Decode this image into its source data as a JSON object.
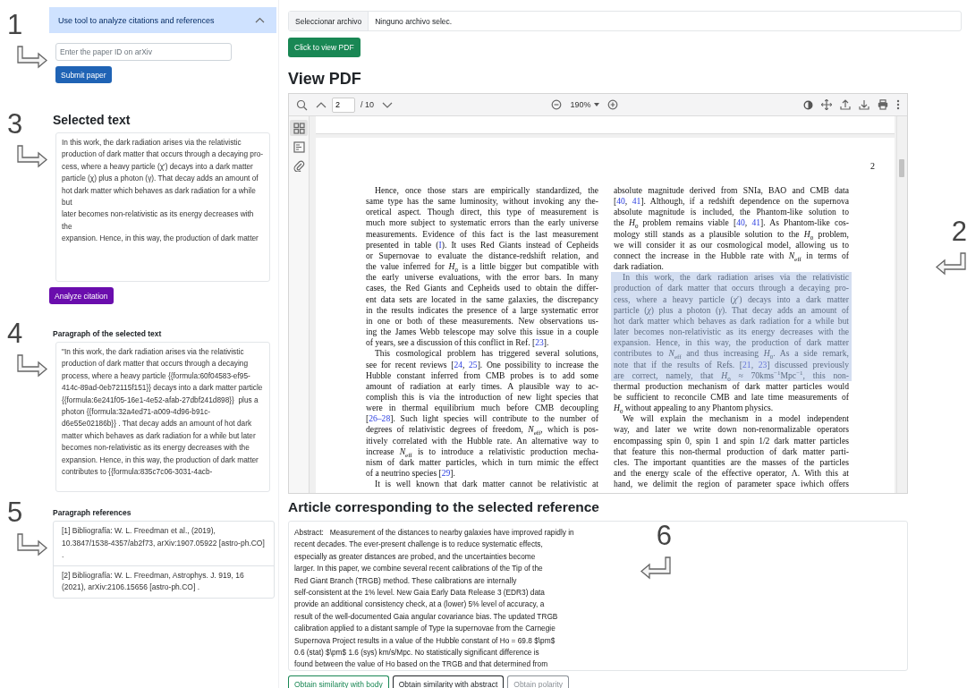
{
  "sidebar": {
    "accordion": {
      "title": "Use tool to analyze citations and references",
      "expanded": true
    },
    "paper_id_field": {
      "placeholder": "Enter the paper ID on arXiv",
      "marker": {
        "label": "1",
        "kind": "right"
      }
    },
    "submit_button": "Submit paper",
    "selected_text": {
      "heading": "Selected text",
      "value": "In this work, the dark radiation arises via the relativistic production of dark matter that occurs through a decaying pro-\ncess, where a heavy particle (χ′) decays into a dark matter particle (χ) plus a photon (γ). That decay adds an amount of\nhot dark matter which behaves as dark radiation for a while but\nlater becomes non-relativistic as its energy decreases with the\nexpansion. Hence, in this way, the production of dark matter",
      "marker": {
        "label": "3",
        "kind": "right"
      }
    },
    "analyze_button": "Analyze citation",
    "paragraph": {
      "heading": "Paragraph of the selected text",
      "value": "\"In this work, the dark radiation arises via the relativistic production of dark matter that occurs through a decaying process, where a heavy particle {{formula:60f04583-ef95-414c-89ad-0eb72115f151}} decays into a dark matter particle {{formula:6e241f05-16e1-4e52-afab-27dbf241d898}}  plus a photon {{formula:32a4ed71-a009-4d96-b91c-d6e55e02186b}} . That decay adds an amount of hot dark matter which behaves as dark radiation for a while but later becomes non-relativistic as its energy decreases with the expansion. Hence, in this way, the production of dark matter contributes to {{formula:835c7c06-3031-4acb-",
      "marker": {
        "label": "4",
        "kind": "right"
      }
    },
    "references": {
      "heading": "Paragraph references",
      "items": [
        "[1] Bibliografía: W. L. Freedman et al., (2019), 10.3847/1538-4357/ab2f73, arXiv:1907.05922 [astro-ph.CO] .",
        "[2] Bibliografía: W. L. Freedman, Astrophys. J. 919, 16 (2021), arXiv:2106.15656 [astro-ph.CO] ."
      ],
      "marker": {
        "label": "5",
        "kind": "right"
      }
    }
  },
  "file_input": {
    "button": "Seleccionar archivo",
    "value": "Ninguno archivo selec."
  },
  "view_pdf_button": "Click to view PDF",
  "pdf_heading": "View PDF",
  "pdf_viewer": {
    "page_field": "2",
    "page_count": "/ 10",
    "zoom": "190%",
    "marker": {
      "label": "2",
      "kind": "left"
    },
    "sidebar_tools": [
      {
        "kind": "thumbnails",
        "selected": true
      },
      {
        "kind": "outline",
        "selected": false
      },
      {
        "kind": "attachments",
        "selected": false
      }
    ],
    "page": {
      "number": "2",
      "columns": [
        {
          "blocks": [
            {
              "indent": true,
              "selected": false,
              "lines": [
                "Hence, once those stars are empirically standardized, the",
                "same type has the same luminosity, without invoking any the-",
                "oretical aspect.  Though direct, this type of measurement is",
                "much more subject to systematic errors than the early universe",
                "measurements. Evidence of this fact is the last measurement",
                [
                  "presented in table (",
                  {
                    "ref": "I"
                  },
                  "). It uses Red Giants instead of Cepheids"
                ],
                "or Supernovae to evaluate the distance-redshift relation, and",
                "the value inferred for *H*$_{0}$ is a little bigger but compatible with",
                "the early universe evaluations, with the error bars.  In many",
                "cases, the Red Giants and Cepheids used to obtain the differ-",
                "ent data sets are located in the same galaxies, the discrepancy",
                "in the results indicates the presence of a large systematic error",
                "in one or both of these measurements.  New observations us-",
                "ing the James Webb telescope may solve this issue in a couple",
                [
                  "of years, see a discussion of this conflict in Ref. [",
                  {
                    "ref": "23"
                  },
                  "]."
                ]
              ]
            },
            {
              "indent": true,
              "selected": false,
              "lines": [
                "This cosmological problem has triggered several solutions,",
                [
                  "see for recent reviews [",
                  {
                    "ref": "24"
                  },
                  ", ",
                  {
                    "ref": "25"
                  },
                  "]. One possibility to increase the"
                ],
                "Hubble constant inferred from CMB probes is to add some",
                "amount of radiation at early times.  A plausible way to ac-",
                "complish this is via the introduction of new light species that",
                "were in thermal equilibrium much before CMB decoupling",
                [
                  "[",
                  {
                    "ref": "26–28"
                  },
                  "]. Such light species will contribute to the number of"
                ],
                "degrees of relativistic degrees of freedom, *N*$_{eff}$, which is pos-",
                "itively correlated with the Hubble rate. An alternative way to",
                "increase *N*$_{eff}$ is to introduce a relativistic production mecha-",
                "nism of dark matter particles, which in turn mimic the effect",
                [
                  "of a neutrino species [",
                  {
                    "ref": "29"
                  },
                  "]."
                ]
              ]
            },
            {
              "indent": true,
              "selected": false,
              "lines": [
                "It is well known that dark matter cannot be relativistic at"
              ]
            }
          ]
        },
        {
          "blocks": [
            {
              "indent": false,
              "selected": false,
              "lines": [
                "absolute magnitude derived from SNIa, BAO and CMB data",
                [
                  "[",
                  {
                    "ref": "40"
                  },
                  ", ",
                  {
                    "ref": "41"
                  },
                  "]. Although, if a redshift dependence on the supernova"
                ],
                "absolute magnitude is included, the Phantom-like solution to",
                [
                  "the *H*$_{0}$ problem remains viable [",
                  {
                    "ref": "40"
                  },
                  ", ",
                  {
                    "ref": "41"
                  },
                  "]. As Phantom-like cos-"
                ],
                "mology still stands as a plausible solution to the *H*$_{0}$ problem,",
                "we will consider it as our cosmological model, allowing us to",
                "connect the increase in the Hubble rate with *N*$_{eff}$ in terms of",
                "dark radiation."
              ]
            },
            {
              "indent": true,
              "selected": true,
              "lines": [
                "In this work, the dark radiation arises via the relativistic",
                "production of dark matter that occurs through a decaying pro-",
                "cess, where a heavy particle (*χ*′) decays into a dark matter",
                "particle (*χ*) plus a photon (*γ*). That decay adds an amount of",
                "hot dark matter which behaves as dark radiation for a while but",
                "later becomes non-relativistic as its energy decreases with the",
                "expansion. Hence, in this way, the production of dark matter",
                "contributes to *N*$_{eff}$ and thus increasing *H*$_{0}$. As a side remark,",
                [
                  "note that if the results of Refs. [",
                  {
                    "ref": "21"
                  },
                  ", ",
                  {
                    "ref": "23"
                  },
                  "] discussed previously"
                ],
                "are correct, namely, that *H*$_{0}$ ≈ 70kms$^{−1}$Mpc$^{−1}$, this non-"
              ]
            },
            {
              "indent": false,
              "selected": false,
              "lines": [
                "thermal production mechanism of dark matter particles would",
                "be sufficient to reconcile CMB and late time measurements of",
                "*H*$_{0}$ without appealing to any Phantom physics."
              ]
            },
            {
              "indent": true,
              "selected": false,
              "lines": [
                "We will explain the mechanism in a model independent",
                "way, and later we write down non-renormalizable operators",
                "encompassing spin 0, spin 1 and spin 1/2 dark matter particles",
                "that feature this non-thermal production of dark matter parti-",
                "cles. The important quantities are the masses of the particles",
                "and the energy scale of the effective operator, Λ. With this at",
                "hand, we delimit the region of parameter space iwhich offers"
              ]
            }
          ]
        }
      ]
    }
  },
  "article_heading": "Article corresponding to the selected reference",
  "abstract": {
    "text": "Abstract:   Measurement of the distances to nearby galaxies have improved rapidly in\nrecent decades. The ever-present challenge is to reduce systematic effects,\nespecially as greater distances are probed, and the uncertainties become\nlarger. In this paper, we combine several recent calibrations of the Tip of the\nRed Giant Branch (TRGB) method. These calibrations are internally\nself-consistent at the 1% level. New Gaia Early Data Release 3 (EDR3) data\nprovide an additional consistency check, at a (lower) 5% level of accuracy, a\nresult of the well-documented Gaia angular covariance bias. The updated TRGB\ncalibration applied to a distant sample of Type Ia supernovae from the Carnegie\nSupernova Project results in a value of the Hubble constant of Ho = 69.8 $\\pm$\n0.6 (stat) $\\pm$ 1.6 (sys) km/s/Mpc. No statistically significant difference is\nfound between the value of Ho based on the TRGB and that determined from",
    "marker": {
      "label": "6",
      "kind": "left"
    }
  },
  "action_buttons": [
    {
      "label": "Obtain similarity with body",
      "kind": "success"
    },
    {
      "label": "Obtain similarity with abstract",
      "kind": "dark"
    },
    {
      "label": "Obtain polarity",
      "kind": "secondary"
    }
  ]
}
